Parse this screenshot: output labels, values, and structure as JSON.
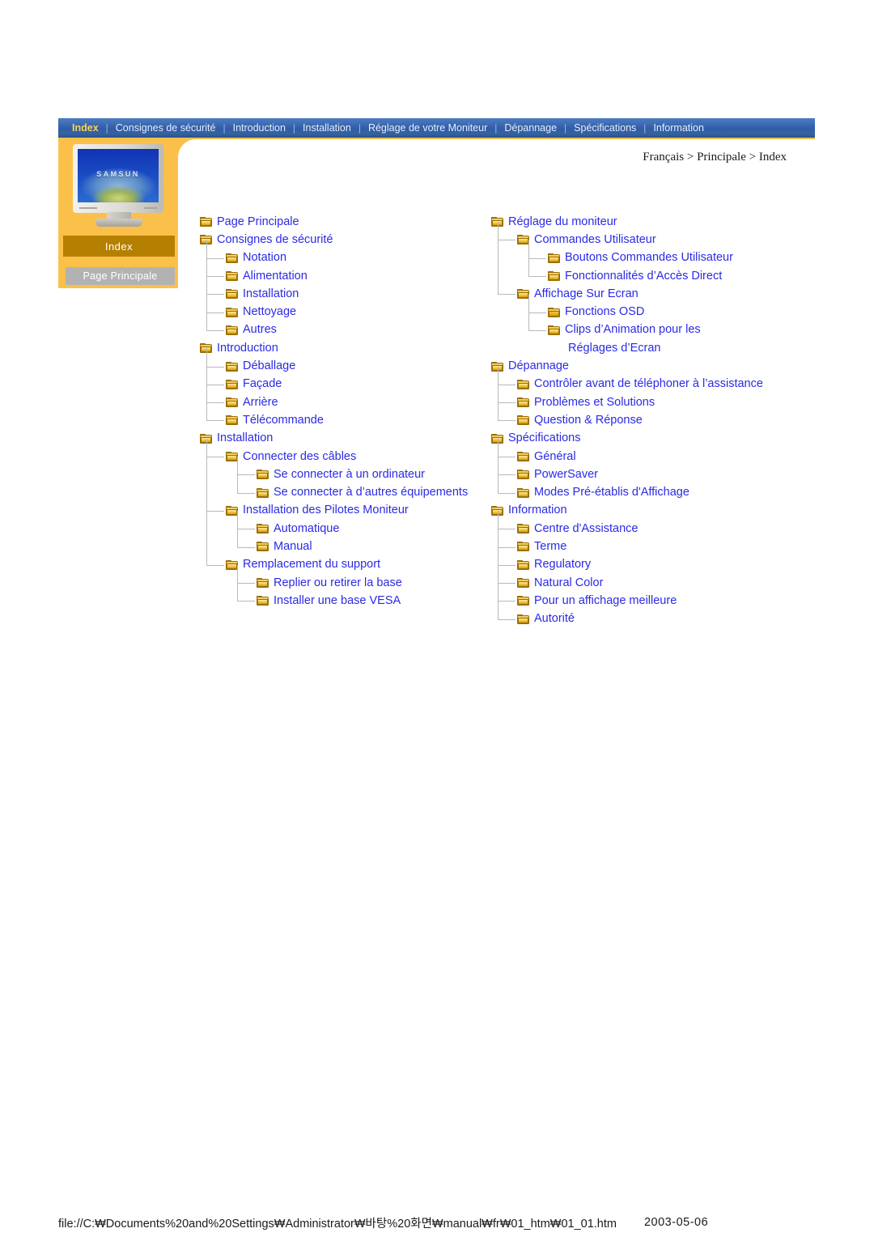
{
  "navbar": {
    "separator": "|",
    "items": [
      {
        "label": "Index",
        "active": true
      },
      {
        "label": "Consignes de sécurité",
        "active": false
      },
      {
        "label": "Introduction",
        "active": false
      },
      {
        "label": "Installation",
        "active": false
      },
      {
        "label": "Réglage de votre Moniteur",
        "active": false
      },
      {
        "label": "Dépannage",
        "active": false
      },
      {
        "label": "Spécifications",
        "active": false
      },
      {
        "label": "Information",
        "active": false
      }
    ]
  },
  "sidebar": {
    "monitor_logo": "SAMSUN",
    "section_label": "Index",
    "home_button": "Page Principale"
  },
  "breadcrumb": "Français > Principale > Index",
  "colors": {
    "nav_bar_blue": "#2f5ca8",
    "nav_active_yellow": "#ffd24d",
    "band_orange": "#fbc04a",
    "index_strip_gold": "#b58000",
    "home_button_gray": "#b2b2b2",
    "link_blue": "#2a2ae6",
    "folder_yellow": "#e7b524",
    "connector_gray": "#b9b9b9"
  },
  "tree": {
    "left_column": [
      {
        "label": "Page Principale",
        "level": 0,
        "icon": "folder-icon"
      },
      {
        "label": "Consignes de sécurité",
        "level": 0,
        "icon": "folder-icon"
      },
      {
        "label": "Notation",
        "level": 1,
        "icon": "folder-icon"
      },
      {
        "label": "Alimentation",
        "level": 1,
        "icon": "folder-icon"
      },
      {
        "label": "Installation",
        "level": 1,
        "icon": "folder-icon"
      },
      {
        "label": "Nettoyage",
        "level": 1,
        "icon": "folder-icon"
      },
      {
        "label": "Autres",
        "level": 1,
        "icon": "folder-icon"
      },
      {
        "label": "Introduction",
        "level": 0,
        "icon": "folder-icon"
      },
      {
        "label": "Déballage",
        "level": 1,
        "icon": "folder-icon"
      },
      {
        "label": "Façade",
        "level": 1,
        "icon": "folder-icon"
      },
      {
        "label": "Arrière",
        "level": 1,
        "icon": "folder-icon"
      },
      {
        "label": "Télécommande",
        "level": 1,
        "icon": "folder-icon"
      },
      {
        "label": "Installation",
        "level": 0,
        "icon": "folder-icon"
      },
      {
        "label": "Connecter des câbles",
        "level": 1,
        "icon": "folder-icon"
      },
      {
        "label": "Se connecter à un ordinateur",
        "level": 2,
        "icon": "folder-icon"
      },
      {
        "label": "Se connecter à d’autres équipements",
        "level": 2,
        "icon": "folder-icon"
      },
      {
        "label": "Installation des Pilotes Moniteur",
        "level": 1,
        "icon": "folder-icon"
      },
      {
        "label": "Automatique",
        "level": 2,
        "icon": "folder-icon"
      },
      {
        "label": "Manual",
        "level": 2,
        "icon": "folder-icon"
      },
      {
        "label": "Remplacement du support",
        "level": 1,
        "icon": "folder-icon"
      },
      {
        "label": "Replier ou retirer la base",
        "level": 2,
        "icon": "folder-icon"
      },
      {
        "label": "Installer une base VESA",
        "level": 2,
        "icon": "folder-icon"
      }
    ],
    "right_column": [
      {
        "label": "Réglage du moniteur",
        "level": 0,
        "icon": "folder-icon"
      },
      {
        "label": "Commandes Utilisateur",
        "level": 1,
        "icon": "folder-icon"
      },
      {
        "label": "Boutons Commandes Utilisateur",
        "level": 2,
        "icon": "folder-icon"
      },
      {
        "label": "Fonctionnalités d’Accès Direct",
        "level": 2,
        "icon": "folder-icon"
      },
      {
        "label": "Affichage Sur Ecran",
        "level": 1,
        "icon": "folder-icon"
      },
      {
        "label": "Fonctions OSD",
        "level": 2,
        "icon": "folder-open-icon"
      },
      {
        "label": "Clips d’Animation pour les",
        "level": 2,
        "icon": "folder-icon"
      },
      {
        "label": "Réglages d’Ecran",
        "level": "cont",
        "icon": "none"
      },
      {
        "label": "Dépannage",
        "level": 0,
        "icon": "folder-icon"
      },
      {
        "label": "Contrôler avant de téléphoner à l’assistance",
        "level": 1,
        "icon": "folder-icon"
      },
      {
        "label": "Problèmes et Solutions",
        "level": 1,
        "icon": "folder-icon"
      },
      {
        "label": "Question & Réponse",
        "level": 1,
        "icon": "folder-icon"
      },
      {
        "label": "Spécifications",
        "level": 0,
        "icon": "folder-icon"
      },
      {
        "label": "Général",
        "level": 1,
        "icon": "folder-icon"
      },
      {
        "label": "PowerSaver",
        "level": 1,
        "icon": "folder-icon"
      },
      {
        "label": "Modes Pré-établis d'Affichage",
        "level": 1,
        "icon": "folder-icon"
      },
      {
        "label": "Information",
        "level": 0,
        "icon": "folder-icon"
      },
      {
        "label": "Centre d'Assistance",
        "level": 1,
        "icon": "folder-icon"
      },
      {
        "label": "Terme",
        "level": 1,
        "icon": "folder-icon"
      },
      {
        "label": "Regulatory",
        "level": 1,
        "icon": "folder-icon"
      },
      {
        "label": "Natural Color",
        "level": 1,
        "icon": "folder-icon"
      },
      {
        "label": "Pour un affichage meilleure",
        "level": 1,
        "icon": "folder-icon"
      },
      {
        "label": "Autorité",
        "level": 1,
        "icon": "folder-icon"
      }
    ]
  },
  "footer": {
    "path": "file://C:₩Documents%20and%20Settings₩Administrator₩바탕%20화면₩manual₩fr₩01_htm₩01_01.htm",
    "date": "2003-05-06"
  }
}
